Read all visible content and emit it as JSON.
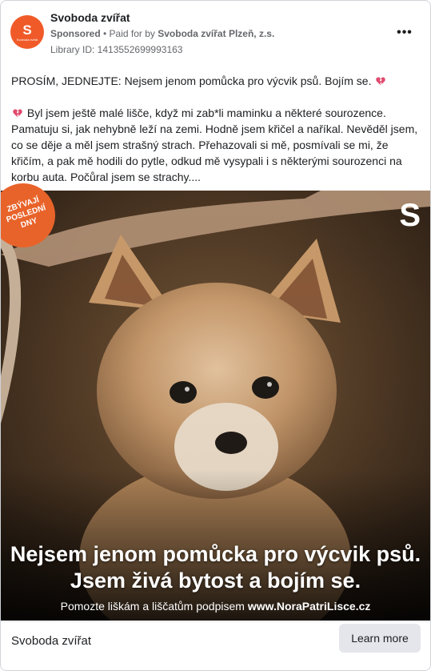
{
  "advertiser": {
    "page_name": "Svoboda zvířat",
    "avatar_letter": "S",
    "avatar_sub": "Svoboda zvířat",
    "sponsored_label": "Sponsored",
    "paid_for_prefix": " • Paid for by ",
    "paid_for_name": "Svoboda zvířat Plzeň, z.s.",
    "library_id": "Library ID: 1413552699993163",
    "brand_color": "#f05a28"
  },
  "post": {
    "line1": "PROSÍM, JEDNEJTE: Nejsem jenom pomůcka pro výcvik psů. Bojím se.",
    "paragraph": "Byl jsem ještě malé lišče, když mi zab*li maminku a některé sourozence. Pamatuju si, jak nehybně leží na zemi. Hodně jsem křičel a naříkal. Nevěděl jsem, co se děje a měl jsem strašný strach. Přehazovali si mě, posmívali se mi, že křičím, a pak mě hodili do pytle, odkud mě vysypali i s některými sourozenci na korbu auta. Počůral jsem se strachy....",
    "emoji": "broken-heart-icon"
  },
  "image": {
    "badge_text": "ZBÝVAJÍ\nPOSLEDNÍ\nDNY",
    "logo_letter": "S",
    "headline": "Nejsem jenom pomůcka pro výcvik psů. Jsem živá bytost a bojím se.",
    "subline_prefix": "Pomozte liškám a liščatům podpisem ",
    "subline_url": "www.NoraPatriLisce.cz",
    "badge_color": "#e8632a"
  },
  "footer": {
    "name": "Svoboda zvířat",
    "cta_label": "Learn more"
  }
}
